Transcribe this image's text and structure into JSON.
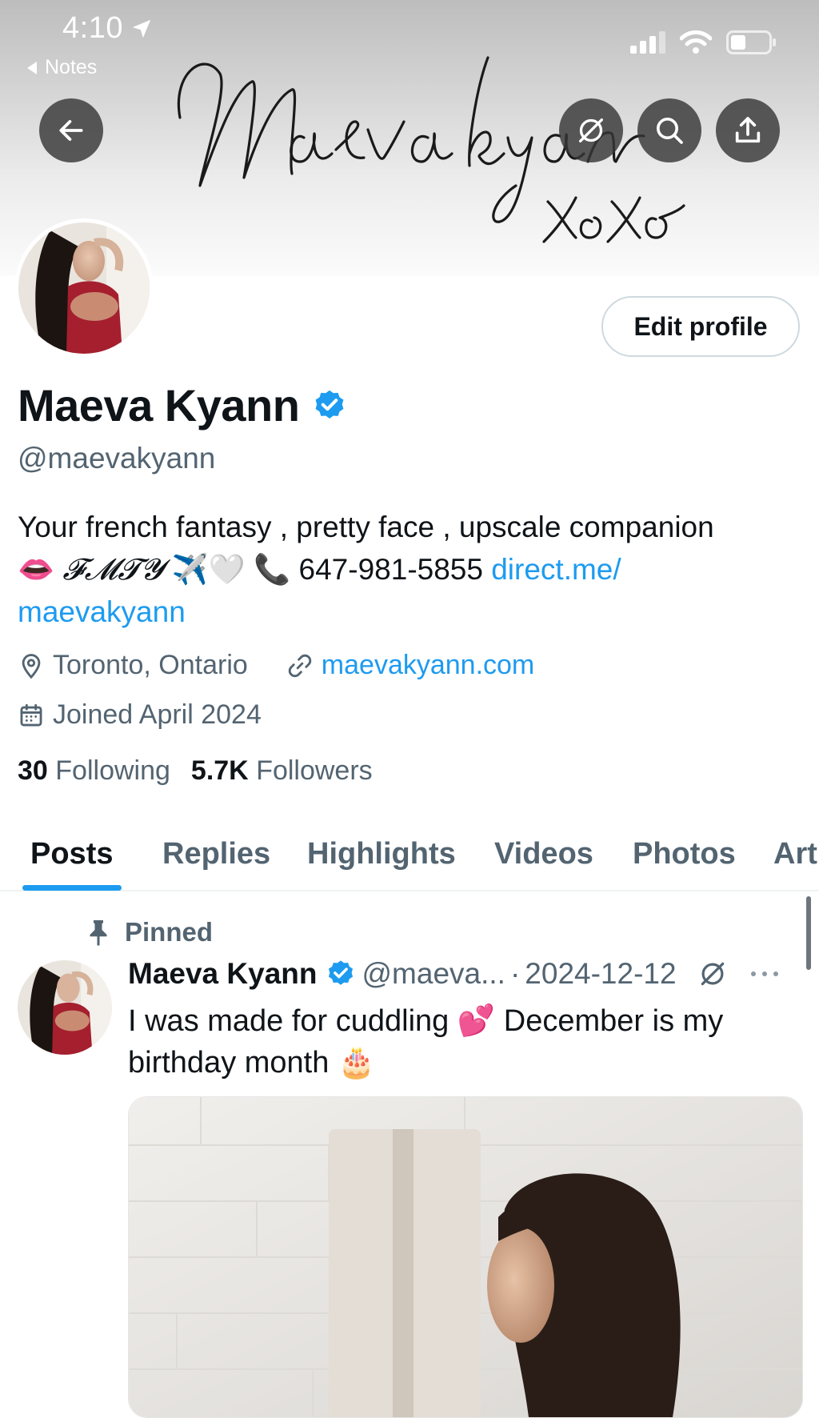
{
  "status_bar": {
    "time": "4:10",
    "back_label": "Notes"
  },
  "banner": {
    "script_text": "Maeva kyann",
    "signoff": "xoxo"
  },
  "header_buttons": {
    "back": "arrow-left-icon",
    "hide": "eye-slash-icon",
    "search": "search-icon",
    "share": "share-icon"
  },
  "profile": {
    "edit_label": "Edit profile",
    "name": "Maeva Kyann",
    "handle": "@maevakyann",
    "bio_line1": "Your french fantasy , pretty face , upscale companion",
    "bio_lips": "👄",
    "bio_fancy": "𝓕𝓜𝓣𝓨",
    "bio_emojis": "✈️🤍",
    "bio_phone_emoji": "📞",
    "bio_phone": "647-981-5855",
    "bio_link_part1": "direct.me/",
    "bio_link_part2": "maevakyann",
    "location": "Toronto, Ontario",
    "website": "maevakyann.com",
    "joined": "Joined April 2024",
    "following_count": "30",
    "following_label": "Following",
    "followers_count": "5.7K",
    "followers_label": "Followers"
  },
  "tabs": [
    {
      "label": "Posts",
      "active": true
    },
    {
      "label": "Replies"
    },
    {
      "label": "Highlights"
    },
    {
      "label": "Videos"
    },
    {
      "label": "Photos"
    },
    {
      "label": "Art"
    }
  ],
  "post": {
    "pinned_label": "Pinned",
    "author": "Maeva Kyann",
    "handle": "@maeva...",
    "separator": "·",
    "date": "2024-12-12",
    "text_part1": "I was made for cuddling",
    "heart_emoji": "💕",
    "text_part2": "December is my",
    "text_line2": "birthday month",
    "cake_emoji": "🎂"
  },
  "colors": {
    "accent": "#1d9bf0",
    "secondary_text": "#536471",
    "primary_text": "#0f1419",
    "verified": "#1d9bf0"
  }
}
